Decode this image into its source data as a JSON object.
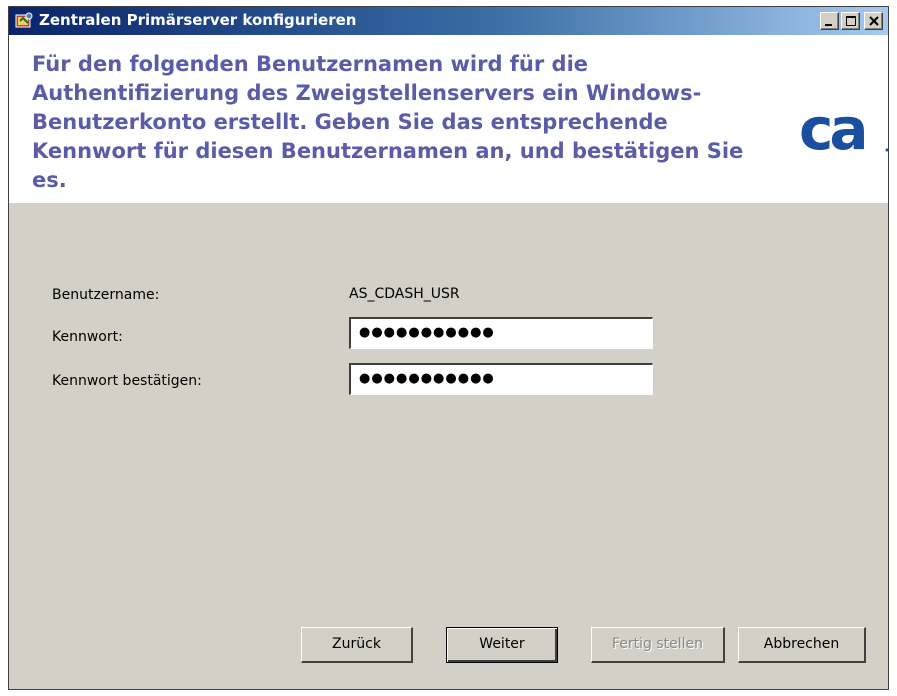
{
  "window": {
    "title": "Zentralen Primärserver konfigurieren",
    "controls": {
      "minimize_icon": "minimize-icon",
      "maximize_icon": "maximize-icon",
      "close_icon": "close-icon"
    }
  },
  "header": {
    "instructions": "Für den folgenden Benutzernamen wird für die Authentifizierung des Zweigstellenservers ein Windows-Benutzerkonto erstellt. Geben Sie das entsprechende Kennwort für diesen Benutzernamen an, und bestätigen Sie es.",
    "logo_text": "ca",
    "logo_color": "#1a4fa0",
    "accent_color": "#5b5ca7"
  },
  "form": {
    "username_label": "Benutzername:",
    "username_value": "AS_CDASH_USR",
    "password_label": "Kennwort:",
    "password_value": "●●●●●●●●●●●",
    "confirm_label": "Kennwort bestätigen:",
    "confirm_value": "●●●●●●●●●●●"
  },
  "buttons": {
    "back": "Zurück",
    "next": "Weiter",
    "finish": "Fertig stellen",
    "cancel": "Abbrechen"
  }
}
